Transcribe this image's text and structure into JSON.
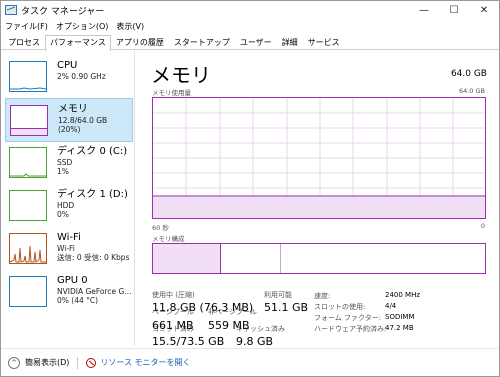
{
  "window": {
    "title": "タスク マネージャー",
    "minimize": "—",
    "maximize": "☐",
    "close": "✕"
  },
  "menu": [
    "ファイル(F)",
    "オプション(O)",
    "表示(V)"
  ],
  "tabs": [
    "プロセス",
    "パフォーマンス",
    "アプリの履歴",
    "スタートアップ",
    "ユーザー",
    "詳細",
    "サービス"
  ],
  "active_tab": "パフォーマンス",
  "resources": [
    {
      "name": "CPU",
      "sub1": "2% 0.90 GHz",
      "sub2": "",
      "color": "#1f7ab8"
    },
    {
      "name": "メモリ",
      "sub1": "12.8/64.0 GB (20%)",
      "sub2": "",
      "color": "#9b2fae"
    },
    {
      "name": "ディスク 0 (C:)",
      "sub1": "SSD",
      "sub2": "1%",
      "color": "#4da034"
    },
    {
      "name": "ディスク 1 (D:)",
      "sub1": "HDD",
      "sub2": "0%",
      "color": "#4da034"
    },
    {
      "name": "Wi-Fi",
      "sub1": "Wi-Fi",
      "sub2": "送信: 0 受信: 0 Kbps",
      "color": "#b3541e"
    },
    {
      "name": "GPU 0",
      "sub1": "NVIDIA GeForce G...",
      "sub2": "0% (44 °C)",
      "color": "#1f7ab8"
    }
  ],
  "main": {
    "title": "メモリ",
    "total": "64.0 GB",
    "usage_label": "メモリ使用量",
    "usage_max": "64.0 GB",
    "time_left": "60 秒",
    "time_right": "0",
    "composition_label": "メモリ構成",
    "usage_fraction": 0.2,
    "composition": {
      "in_use": 0.2,
      "modified": 0.005,
      "standby": 0.18
    }
  },
  "stats": {
    "in_use_label": "使用中 (圧縮)",
    "in_use_value": "11.8 GB (76.3 MB)",
    "available_label": "利用可能",
    "available_value": "51.1 GB",
    "committed_label": "コミット済み",
    "committed_value": "15.5/73.5 GB",
    "cached_label": "キャッシュ済み",
    "cached_value": "9.8 GB",
    "paged_label": "ページプール",
    "paged_value": "661 MB",
    "nonpaged_label": "非ページプール",
    "nonpaged_value": "559 MB"
  },
  "props": {
    "speed_label": "速度:",
    "speed_value": "2400 MHz",
    "slots_label": "スロットの使用:",
    "slots_value": "4/4",
    "form_label": "フォーム ファクター:",
    "form_value": "SODIMM",
    "reserved_label": "ハードウェア予約済み:",
    "reserved_value": "47.2 MB"
  },
  "footer": {
    "brief_label": "簡易表示(D)",
    "monitor_label": "リソース モニターを開く"
  }
}
